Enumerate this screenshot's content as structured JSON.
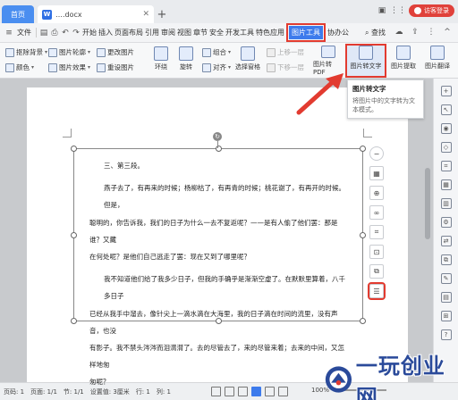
{
  "titlebar": {
    "home_tab": "首页",
    "doc_tab": "….docx",
    "doc_icon": "W",
    "new_tab": "+",
    "guest_label": "访客登录"
  },
  "menubar": {
    "file": "文件",
    "tabs": [
      "开始",
      "插入",
      "页面布局",
      "引用",
      "审阅",
      "视图",
      "章节",
      "安全",
      "开发工具",
      "特色应用"
    ],
    "active_tab": "图片工具",
    "after_tab": "协办公",
    "search": "查找"
  },
  "ribbon": {
    "col1": [
      "抠除背景",
      "颜色"
    ],
    "col2": [
      "图片轮廓",
      "图片效果"
    ],
    "col3": [
      "更改图片",
      "重设图片"
    ],
    "col4": [
      "环绕"
    ],
    "col5": [
      "旋转"
    ],
    "col6": [
      "组合",
      "对齐"
    ],
    "col7": [
      "选择窗格"
    ],
    "col8": [
      "上移一层",
      "下移一层"
    ],
    "big1": "图片转PDF",
    "big2": "图片转文字",
    "big3": "图片提取",
    "big4": "图片翻译"
  },
  "tooltip": {
    "title": "图片转文字",
    "desc": "将图片中的文字转为文本模式。"
  },
  "document": {
    "heading": "三、第三段。",
    "para1_lines": [
      "燕子去了，有再来的时候；杨柳枯了，有再青的时候；桃花谢了，有再开的时候。但是，",
      "聪明的，你告诉我，我们的日子为什么一去不复返呢？——是有人偷了他们罢：那是谁？又藏",
      "在何处呢？是他们自己逃走了罢：现在又到了哪里呢？"
    ],
    "para2_lines": [
      "我不知道他们给了我多少日子，但我的手确乎是渐渐空虚了。在默默里算着，八千多日子",
      "已经从我手中溜去，像针尖上一滴水滴在大海里，我的日子滴在时间的流里，没有声音，也没",
      "有影子。我不禁头涔涔而泪潸潸了。去的尽管去了，来的尽管来着；去来的中间，又怎样地匆",
      "匆呢？"
    ]
  },
  "statusbar": {
    "page": "页码: 1",
    "pages": "页面: 1/1",
    "section": "节: 1/1",
    "setting": "设置值: 3厘米",
    "row": "行: 1",
    "col": "列: 1",
    "zoom": "100%"
  },
  "watermark": {
    "text": "一玩创业网"
  },
  "colors": {
    "accent": "#3d7bec",
    "highlight": "#e23b30",
    "guest": "#e0413a"
  }
}
